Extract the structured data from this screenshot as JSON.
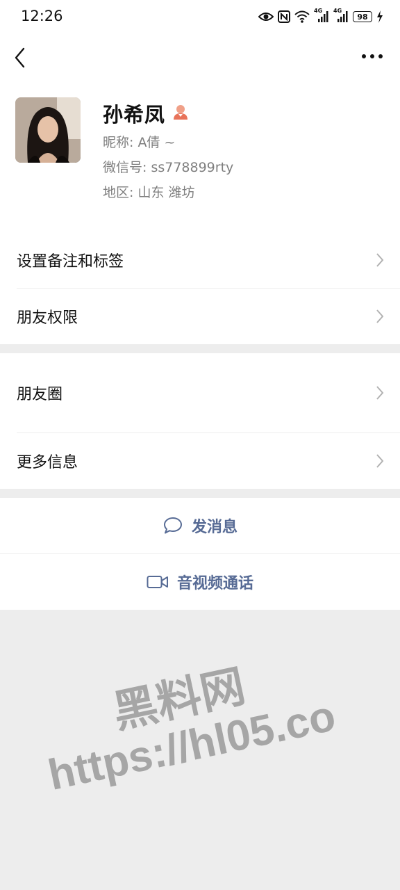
{
  "status_bar": {
    "time": "12:26",
    "network_1": "4G",
    "network_2": "4G",
    "battery": "98",
    "icons": [
      "eye-icon",
      "nfc-icon",
      "wifi-icon",
      "signal-icon",
      "signal-icon",
      "battery-icon",
      "charging-icon"
    ]
  },
  "nav": {
    "back_icon": "chevron-left-icon",
    "more_icon": "more-dots-icon"
  },
  "profile": {
    "name": "孙希凤",
    "nickname": "昵称: A倩 ~",
    "wechat_id": "微信号: ss778899rty",
    "region": "地区: 山东  潍坊",
    "gender_icon": "female-icon",
    "gender_color": "#fa5151"
  },
  "menu_group_1": [
    {
      "label": "设置备注和标签"
    },
    {
      "label": "朋友权限"
    }
  ],
  "menu_group_2": [
    {
      "label": "朋友圈"
    },
    {
      "label": "更多信息"
    }
  ],
  "actions": {
    "send_message": "发消息",
    "video_call": "音视频通话"
  },
  "watermark": {
    "line1": "黑料网",
    "line2": "https://hl05.co"
  },
  "colors": {
    "link": "#576b95",
    "background": "#ededed"
  }
}
